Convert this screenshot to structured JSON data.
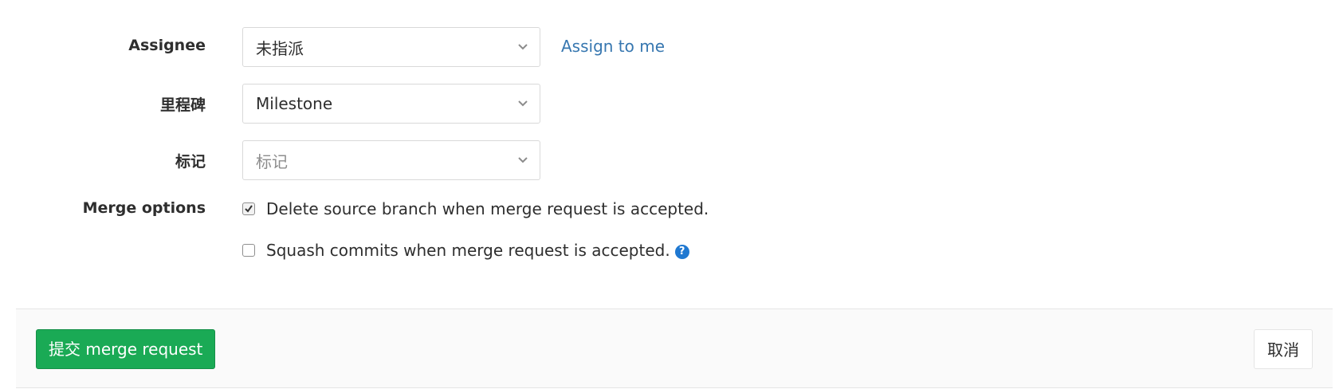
{
  "form": {
    "assignee": {
      "label": "Assignee",
      "value": "未指派",
      "assign_link": "Assign to me"
    },
    "milestone": {
      "label": "里程碑",
      "value": "Milestone"
    },
    "labels": {
      "label": "标记",
      "placeholder": "标记"
    },
    "merge_options": {
      "label": "Merge options",
      "delete_source_branch": {
        "text": "Delete source branch when merge request is accepted.",
        "checked": true
      },
      "squash_commits": {
        "text": "Squash commits when merge request is accepted.",
        "checked": false,
        "help_icon": "question-circle-icon"
      }
    }
  },
  "footer": {
    "submit_label": "提交 merge request",
    "cancel_label": "取消"
  },
  "colors": {
    "link": "#3777b0",
    "submit_bg": "#1aaa55",
    "help_icon": "#1f78d1"
  }
}
